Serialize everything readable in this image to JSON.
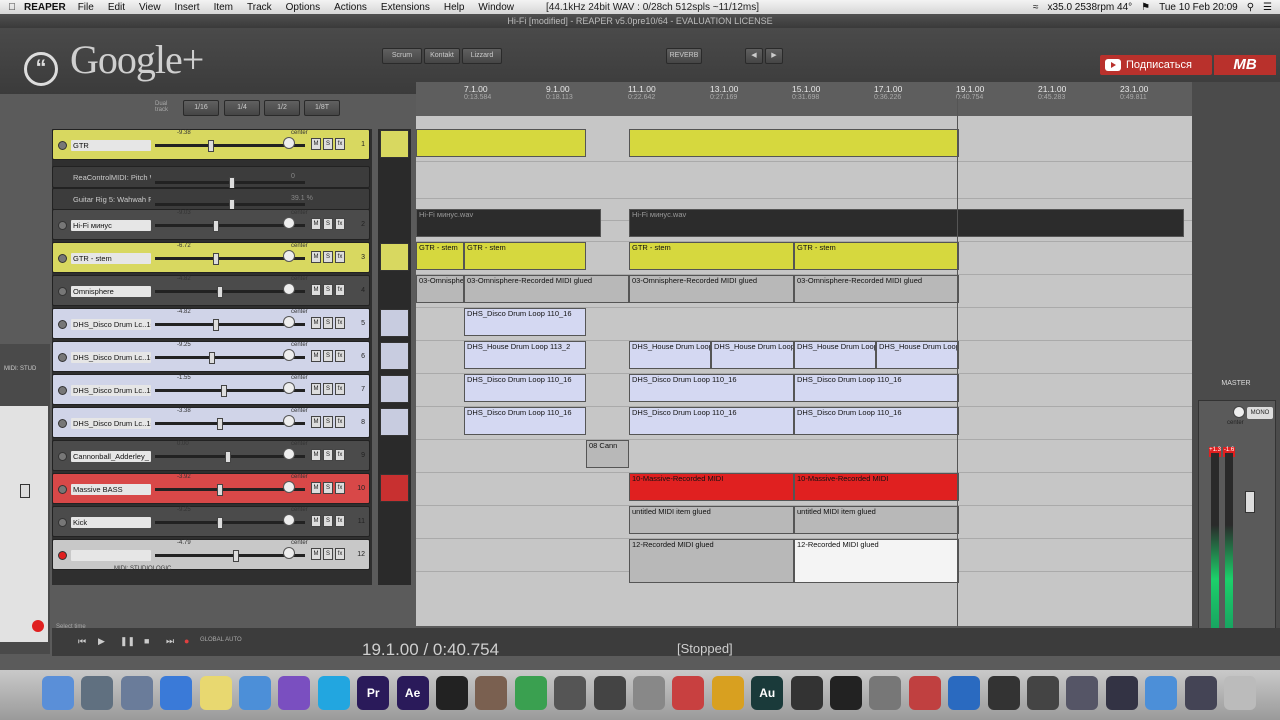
{
  "menubar": {
    "app": "REAPER",
    "items": [
      "File",
      "Edit",
      "View",
      "Insert",
      "Item",
      "Track",
      "Options",
      "Actions",
      "Extensions",
      "Help",
      "Window"
    ],
    "status": "[44.1kHz 24bit WAV : 0/28ch 512spls ~11/12ms]",
    "rpm": "x35.0 2538rpm 44°",
    "datetime": "Tue 10 Feb  20:09"
  },
  "window": {
    "title": "Hi-Fi [modified] - REAPER v5.0pre10/64 - EVALUATION LICENSE"
  },
  "overlay": {
    "google": "Google+",
    "subscribe": "Подписаться",
    "mb": "MB"
  },
  "toolbar": {
    "buttons": [
      "Scrum",
      "Kontakt",
      "Lizzard",
      "REVERB"
    ],
    "grid": [
      "1/16",
      "1/4",
      "1/2",
      "1/8T"
    ],
    "dual_track": "Dual track"
  },
  "ruler": [
    {
      "bar": "7.1.00",
      "time": "0:13.584"
    },
    {
      "bar": "9.1.00",
      "time": "0:18.113"
    },
    {
      "bar": "11.1.00",
      "time": "0:22.642"
    },
    {
      "bar": "13.1.00",
      "time": "0:27.169"
    },
    {
      "bar": "15.1.00",
      "time": "0:31.698"
    },
    {
      "bar": "17.1.00",
      "time": "0:36.226"
    },
    {
      "bar": "19.1.00",
      "time": "0:40.754"
    },
    {
      "bar": "21.1.00",
      "time": "0:45.283"
    },
    {
      "bar": "23.1.00",
      "time": "0:49.811"
    }
  ],
  "tracks": [
    {
      "name": "GTR",
      "num": "1",
      "vol": "-9.38",
      "pan": "center"
    },
    {
      "name": "ReaControlMIDI: Pitch Whee",
      "num": "",
      "vol": "0",
      "pan": ""
    },
    {
      "name": "Guitar Rig 5: Wahwah Pedal",
      "num": "",
      "vol": "39.1 %",
      "pan": ""
    },
    {
      "name": "Hi-Fi минус",
      "num": "2",
      "vol": "-9.03",
      "pan": "center"
    },
    {
      "name": "GTR - stem",
      "num": "3",
      "vol": "-6.72",
      "pan": "center"
    },
    {
      "name": "Omnisphere",
      "num": "4",
      "vol": "-4.82",
      "pan": "center"
    },
    {
      "name": "DHS_Disco Drum Lc..16",
      "num": "5",
      "vol": "-4.82",
      "pan": "center"
    },
    {
      "name": "DHS_Disco Drum Lc..16",
      "num": "6",
      "vol": "-9.25",
      "pan": "center"
    },
    {
      "name": "DHS_Disco Drum Lc..16",
      "num": "7",
      "vol": "-1.55",
      "pan": "center"
    },
    {
      "name": "DHS_Disco Drum Lc..16",
      "num": "8",
      "vol": "-3.38",
      "pan": "center"
    },
    {
      "name": "Cannonball_Adderley_",
      "num": "9",
      "vol": "0.00",
      "pan": "center"
    },
    {
      "name": "Massive BASS",
      "num": "10",
      "vol": "-3.92",
      "pan": "center"
    },
    {
      "name": "Kick",
      "num": "11",
      "vol": "-9.25",
      "pan": "center"
    },
    {
      "name": "",
      "num": "12",
      "vol": "-4.79",
      "pan": "center"
    }
  ],
  "track12_sub": "MIDI: STUDIOLOGIC",
  "items": {
    "gtr_stem": "GTR - stem",
    "omni": "03-Omnisphere-Recorded MIDI glued",
    "disco1": "DHS_Disco Drum Loop 110_16",
    "house": "DHS_House Drum Loop 113_2",
    "disco2": "DHS_Disco Drum Loop 110_16",
    "disco3": "DHS_Disco Drum Loop 110_16",
    "canno": "08 Cann",
    "massive": "10-Massive-Recorded MIDI",
    "untitled": "untitled MIDI item glued",
    "rec12": "12-Recorded MIDI glued",
    "hifi": "Hi-Fi минус.wav"
  },
  "master": {
    "label": "MASTER",
    "mono": "MONO",
    "center": "center",
    "peakL": "+1.3",
    "peakR": "-1.6"
  },
  "transport": {
    "clock": "19.1.00 / 0:40.754",
    "state": "[Stopped]",
    "global": "GLOBAL AUTO",
    "select": "Select time"
  },
  "left_mixer": {
    "label": "MIDI: STUD"
  },
  "dock": [
    "Finder",
    "Launchpad",
    "System",
    "WiFi",
    "Stickies",
    "Chrome",
    "Viber",
    "Skype",
    "Pr",
    "Ae",
    "Terminal",
    "Automator",
    "Maps",
    "Apps",
    "Clock",
    "Preview",
    "Toolbox",
    "Wave",
    "Au",
    "Utility",
    "Piano",
    "Prefs",
    "REAPER",
    "TeamViewer",
    "Disk",
    "Mic",
    "Sys",
    "Monitor",
    "Chrome",
    "Monitor2",
    "Trash"
  ]
}
